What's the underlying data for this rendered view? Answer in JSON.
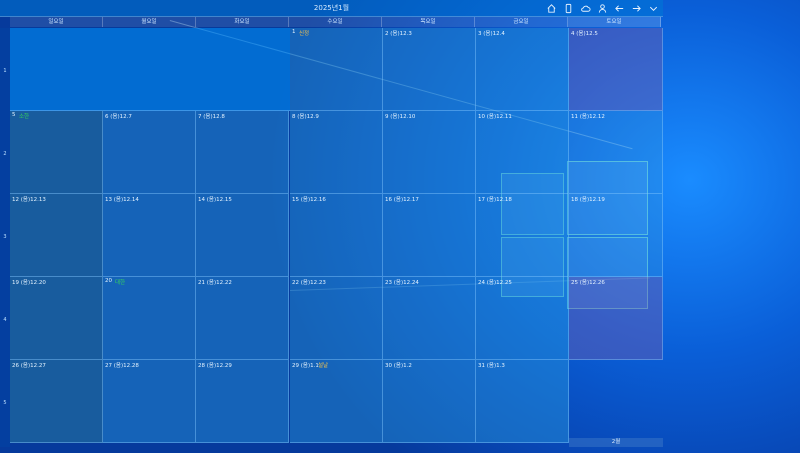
{
  "title": "2025년1월",
  "toolbar": {
    "icons": [
      "home-icon",
      "phone-icon",
      "cloud-icon",
      "person-icon",
      "arrow-left-icon",
      "arrow-right-icon",
      "chevron-down-icon"
    ]
  },
  "weekdays": [
    "일요일",
    "월요일",
    "화요일",
    "수요일",
    "목요일",
    "금요일",
    "토요일"
  ],
  "weeks": [
    "1",
    "2",
    "3",
    "4",
    "5"
  ],
  "days": [
    {
      "label": "1",
      "hol": "신정"
    },
    {
      "label": "2 (음)12.3"
    },
    {
      "label": "3 (음)12.4"
    },
    {
      "label": "4 (음)12.5"
    },
    {
      "label": "5",
      "green": "소한"
    },
    {
      "label": "6 (음)12.7"
    },
    {
      "label": "7 (음)12.8"
    },
    {
      "label": "8 (음)12.9"
    },
    {
      "label": "9 (음)12.10"
    },
    {
      "label": "10 (음)12.11"
    },
    {
      "label": "11 (음)12.12"
    },
    {
      "label": "12 (음)12.13"
    },
    {
      "label": "13 (음)12.14"
    },
    {
      "label": "14 (음)12.15"
    },
    {
      "label": "15 (음)12.16"
    },
    {
      "label": "16 (음)12.17"
    },
    {
      "label": "17 (음)12.18"
    },
    {
      "label": "18 (음)12.19"
    },
    {
      "label": "19 (음)12.20"
    },
    {
      "label": "20",
      "green": "대한"
    },
    {
      "label": "21 (음)12.22"
    },
    {
      "label": "22 (음)12.23"
    },
    {
      "label": "23 (음)12.24"
    },
    {
      "label": "24 (음)12.25"
    },
    {
      "label": "25 (음)12.26"
    },
    {
      "label": "26 (음)12.27"
    },
    {
      "label": "27 (음)12.28"
    },
    {
      "label": "28 (음)12.29"
    },
    {
      "label": "29 (음)1.1",
      "hol": "설날"
    },
    {
      "label": "30 (음)1.2"
    },
    {
      "label": "31 (음)1.3"
    }
  ],
  "footer": "2월",
  "colors": {
    "holiday": "#f2c14e",
    "solar_term": "#35d35d",
    "accent": "#0078d7"
  }
}
